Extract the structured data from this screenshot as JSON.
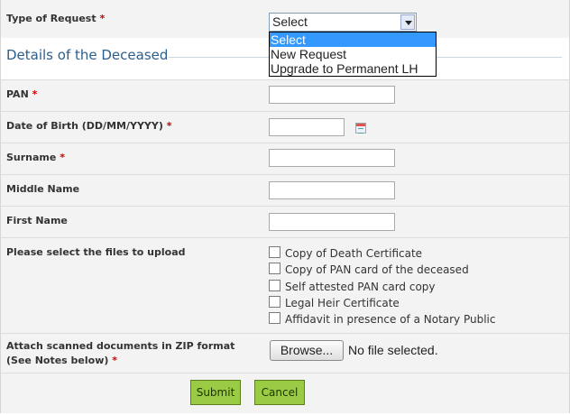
{
  "form": {
    "type_of_request_label": "Type of Request",
    "required_marker": "*",
    "section_title": "Details of the Deceased",
    "pan_label": "PAN",
    "dob_label": "Date of Birth (DD/MM/YYYY)",
    "surname_label": "Surname",
    "middle_name_label": "Middle Name",
    "first_name_label": "First Name",
    "files_label": "Please select the files to upload",
    "attach_label_line1": "Attach scanned documents in ZIP format",
    "attach_label_line2": "(See Notes below)",
    "browse_label": "Browse...",
    "no_file_text": "No file selected.",
    "submit_label": "Submit",
    "cancel_label": "Cancel"
  },
  "request_select": {
    "selected": "Select",
    "options": [
      "Select",
      "New Request",
      "Upgrade to Permanent LH"
    ]
  },
  "upload_files": [
    "Copy of Death Certificate",
    "Copy of PAN card of the deceased",
    "Self attested PAN card copy",
    "Legal Heir Certificate",
    "Affidavit in presence of a Notary Public"
  ],
  "colors": {
    "section_title": "#2b5e8c",
    "required": "#cc0000",
    "button_green": "#99cc44",
    "dropdown_highlight": "#3399ff"
  }
}
